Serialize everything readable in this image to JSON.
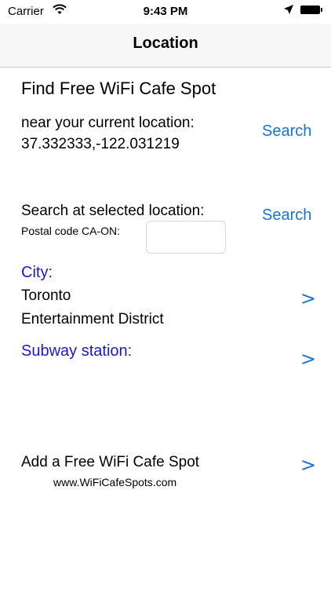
{
  "status": {
    "carrier": "Carrier",
    "time": "9:43 PM"
  },
  "nav": {
    "title": "Location"
  },
  "main": {
    "heading": "Find Free WiFi Cafe Spot",
    "near_label": "near your current location:",
    "coordinates": "37.332333,-122.031219",
    "search_current_label": "Search",
    "selected_label": "Search at selected location:",
    "search_selected_label": "Search",
    "postal_label": "Postal code CA-ON:",
    "postal_value": "",
    "city_header": "City:",
    "city_line1": "Toronto",
    "city_line2": "Entertainment District",
    "subway_header": "Subway station:",
    "add_label": "Add a Free WiFi Cafe Spot",
    "website": "www.WiFiCafeSpots.com",
    "chevron": ">"
  },
  "colors": {
    "link": "#1a73d1",
    "section": "#1a1acc"
  }
}
